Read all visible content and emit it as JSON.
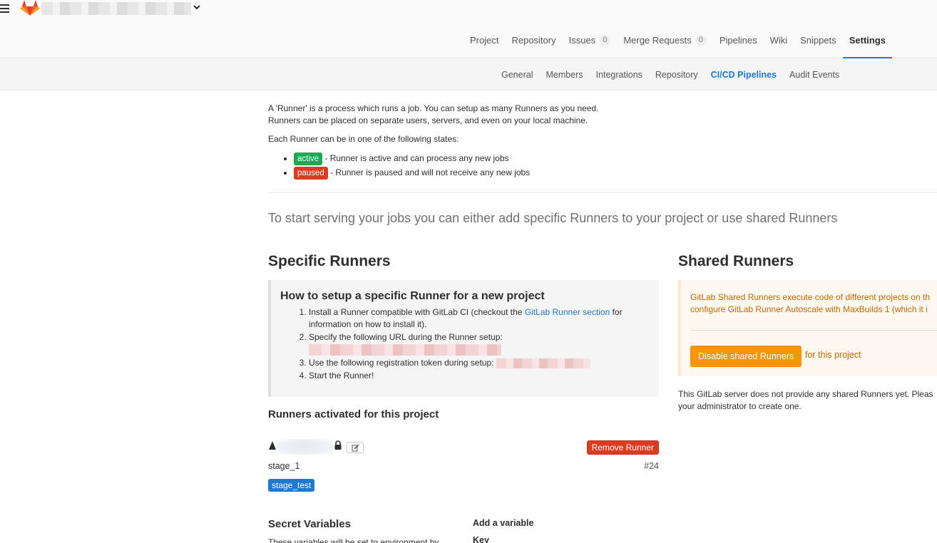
{
  "nav": {
    "tabs": [
      {
        "label": "Project"
      },
      {
        "label": "Repository"
      },
      {
        "label": "Issues",
        "badge": "0"
      },
      {
        "label": "Merge Requests",
        "badge": "0"
      },
      {
        "label": "Pipelines"
      },
      {
        "label": "Wiki"
      },
      {
        "label": "Snippets"
      },
      {
        "label": "Settings"
      }
    ]
  },
  "subnav": {
    "tabs": [
      "General",
      "Members",
      "Integrations",
      "Repository",
      "CI/CD Pipelines",
      "Audit Events"
    ]
  },
  "intro": {
    "line1": "A 'Runner' is a process which runs a job. You can setup as many Runners as you need.",
    "line2": "Runners can be placed on separate users, servers, and even on your local machine.",
    "states_heading": "Each Runner can be in one of the following states:",
    "active_label": "active",
    "active_desc": " - Runner is active and can process any new jobs",
    "paused_label": "paused",
    "paused_desc": " - Runner is paused and will not receive any new jobs"
  },
  "lead": "To start serving your jobs you can either add specific Runners to your project or use shared Runners",
  "specific": {
    "title": "Specific Runners",
    "howto_title": "How to setup a specific Runner for a new project",
    "step1_pre": "Install a Runner compatible with GitLab CI (checkout the ",
    "step1_link": "GitLab Runner section",
    "step1_post": " for information on how to install it).",
    "step2": "Specify the following URL during the Runner setup:",
    "step3": "Use the following registration token during setup: ",
    "step4": "Start the Runner!",
    "activated_title": "Runners activated for this project",
    "runner": {
      "description": "stage_1",
      "id": "#24",
      "tag": "stage_test",
      "remove_label": "Remove Runner"
    }
  },
  "shared": {
    "title": "Shared Runners",
    "info_line1": "GitLab Shared Runners execute code of different projects on th",
    "info_line2": "configure GitLab Runner Autoscale with MaxBuilds 1 (which it i",
    "disable_label": "Disable shared Runners",
    "for_project": "for this project",
    "none_line1": "This GitLab server does not provide any shared Runners yet. Pleas",
    "none_line2": "your administrator to create one."
  },
  "secret": {
    "title": "Secret Variables",
    "subtitle": "These variables will be set to environment by",
    "add_variable": "Add a variable",
    "key_label": "Key"
  },
  "colors": {
    "accent": "#1f78d1",
    "active": "#1aaa55",
    "danger": "#db3b21",
    "warning": "#fc9403"
  }
}
